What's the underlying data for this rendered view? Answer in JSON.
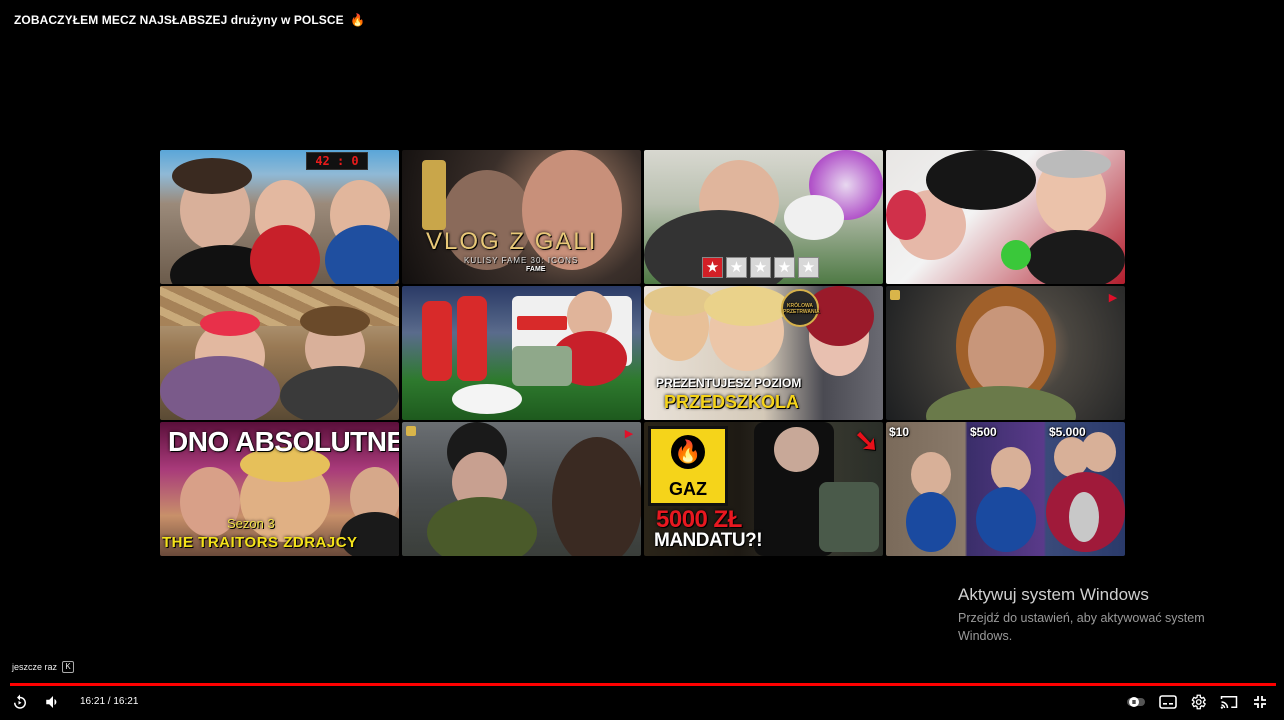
{
  "video": {
    "title": "ZOBACZYŁEM MECZ NAJSŁABSZEJ drużyny w POLSCE",
    "title_emoji": "🔥"
  },
  "end_screen": {
    "thumbnails": [
      {
        "id": "t1",
        "overlay_text": "42 : 0"
      },
      {
        "id": "t2",
        "overlay_text": "VLOG Z GALI",
        "subtext": "KULISY FAME 30: ICONS",
        "brand": "FAME"
      },
      {
        "id": "t3",
        "rating": 1,
        "rating_max": 5
      },
      {
        "id": "t4"
      },
      {
        "id": "t5"
      },
      {
        "id": "t6"
      },
      {
        "id": "t7",
        "overlay_text": "PREZENTUJESZ POZIOM",
        "overlay_text2": "PRZEDSZKOLA",
        "badge_text": "KRÓLOWA PRZETRWANIA"
      },
      {
        "id": "t8"
      },
      {
        "id": "t9",
        "overlay_text": "DNO ABSOLUTNE!",
        "subtext": "Sezon 3",
        "overlay_text2": "THE TRAITORS ZDRAJCY"
      },
      {
        "id": "t10"
      },
      {
        "id": "t11",
        "sign_text": "GAZ",
        "overlay_text": "5000 ZŁ",
        "overlay_text2": "MANDATU?!"
      },
      {
        "id": "t12",
        "prices": [
          "$10",
          "$500",
          "$5.000"
        ]
      }
    ]
  },
  "windows_activation": {
    "heading": "Aktywuj system Windows",
    "line1": "Przejdź do ustawień, aby aktywować system",
    "line2": "Windows."
  },
  "replay": {
    "label": "jeszcze raz",
    "key": "K"
  },
  "player": {
    "current_time": "16:21",
    "duration": "16:21",
    "time_display": "16:21 / 16:21",
    "progress": 1.0,
    "controls": [
      "replay-icon",
      "volume-icon",
      "autoplay-toggle-icon",
      "subtitles-icon",
      "settings-icon",
      "cast-icon",
      "exit-fullscreen-icon"
    ]
  },
  "colors": {
    "progress": "#ff0000",
    "background": "#000000"
  }
}
